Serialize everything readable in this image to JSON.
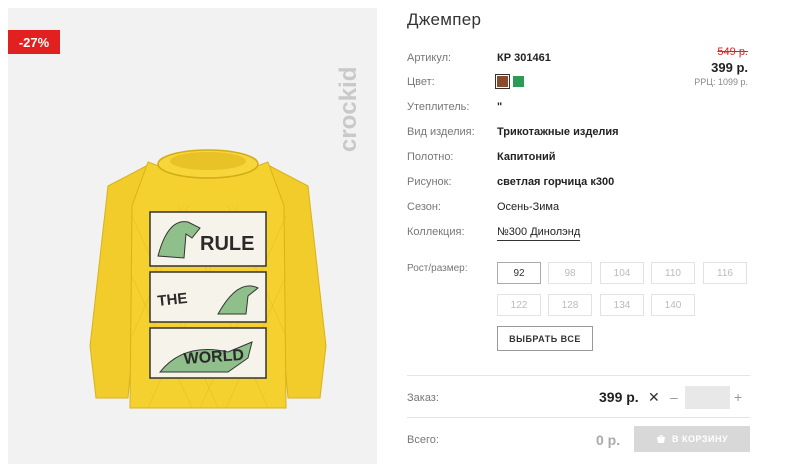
{
  "product": {
    "title": "Джемпер",
    "discount": "-27%",
    "brand": "crockid"
  },
  "price": {
    "old": "549 р.",
    "current": "399 р.",
    "rrc": "РРЦ: 1099 р."
  },
  "attributes": [
    {
      "label": "Артикул:",
      "value": "КР 301461"
    },
    {
      "label": "Цвет:",
      "value": ""
    },
    {
      "label": "Утеплитель:",
      "value": "\""
    },
    {
      "label": "Вид изделия:",
      "value": "Трикотажные изделия"
    },
    {
      "label": "Полотно:",
      "value": "Капитоний"
    },
    {
      "label": "Рисунок:",
      "value": "светлая горчица к300"
    },
    {
      "label": "Сезон:",
      "value": "Осень-Зима"
    },
    {
      "label": "Коллекция:",
      "value": "№300 Динолэнд"
    }
  ],
  "colors": [
    {
      "name": "brown",
      "hex": "#8b4a2b",
      "selected": true
    },
    {
      "name": "green",
      "hex": "#2e9a53",
      "selected": false
    }
  ],
  "sizes": {
    "label": "Рост/размер:",
    "options": [
      "92",
      "98",
      "104",
      "110",
      "116",
      "122",
      "128",
      "134",
      "140"
    ],
    "selected": "92",
    "select_all": "ВЫБРАТЬ ВСЕ"
  },
  "order": {
    "label": "Заказ:",
    "price": "399 р.",
    "times": "✕",
    "minus": "–",
    "plus": "+",
    "quantity": ""
  },
  "total": {
    "label": "Всего:",
    "value": "0 р."
  },
  "cart_button": "В КОРЗИНУ",
  "accent_color": "#e1201f"
}
